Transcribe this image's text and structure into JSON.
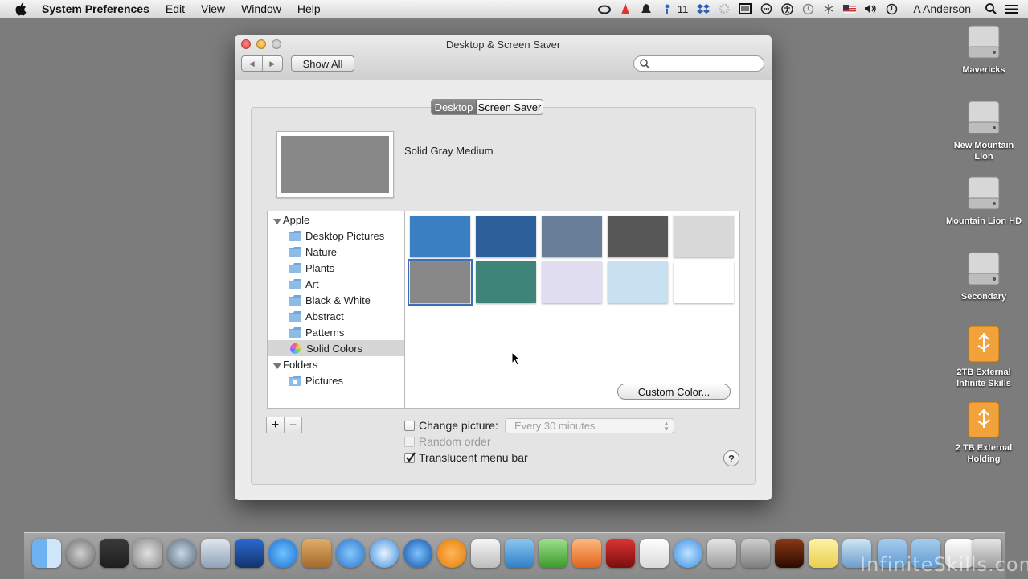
{
  "menubar": {
    "app_name": "System Preferences",
    "menus": [
      "Edit",
      "View",
      "Window",
      "Help"
    ],
    "notification_count": "11",
    "user": "A Anderson",
    "status_icons": [
      "creative-cloud-icon",
      "flame-icon",
      "bell-icon",
      "dropbox-icon",
      "gear-icon",
      "film-icon",
      "chat-icon",
      "accessibility-icon",
      "time-machine-icon",
      "bluetooth-icon",
      "flag-icon",
      "volume-icon",
      "clock-icon"
    ]
  },
  "window": {
    "title": "Desktop & Screen Saver",
    "show_all": "Show All",
    "search_placeholder": "",
    "tabs": {
      "desktop": "Desktop",
      "screen_saver": "Screen Saver"
    },
    "preview_name": "Solid Gray Medium",
    "preview_color": "#888888",
    "sources": {
      "apple_header": "Apple",
      "apple_items": [
        "Desktop Pictures",
        "Nature",
        "Plants",
        "Art",
        "Black & White",
        "Abstract",
        "Patterns",
        "Solid Colors"
      ],
      "folders_header": "Folders",
      "folder_items": [
        "Pictures"
      ],
      "selected": "Solid Colors"
    },
    "colors": [
      "#3a7fc1",
      "#2d5f9a",
      "#697f99",
      "#575757",
      "#d8d8d8",
      "#888888",
      "#3f8479",
      "#e2def2",
      "#c9e0f0",
      "#ffffff"
    ],
    "selected_color_index": 5,
    "custom_color": "Custom Color...",
    "add": "+",
    "remove": "−",
    "change_picture": "Change picture:",
    "interval": "Every 30 minutes",
    "random_order": "Random order",
    "translucent_menu_bar": "Translucent menu bar",
    "help": "?"
  },
  "desktop_icons": [
    {
      "label": "Mavericks",
      "kind": "drive"
    },
    {
      "label": "New Mountain Lion",
      "kind": "drive"
    },
    {
      "label": "Mountain Lion HD",
      "kind": "drive"
    },
    {
      "label": "Secondary",
      "kind": "drive"
    },
    {
      "label": "2TB External Infinite Skills",
      "kind": "usb"
    },
    {
      "label": "2 TB External Holding",
      "kind": "usb"
    }
  ],
  "watermark": "InfiniteSkills.com"
}
